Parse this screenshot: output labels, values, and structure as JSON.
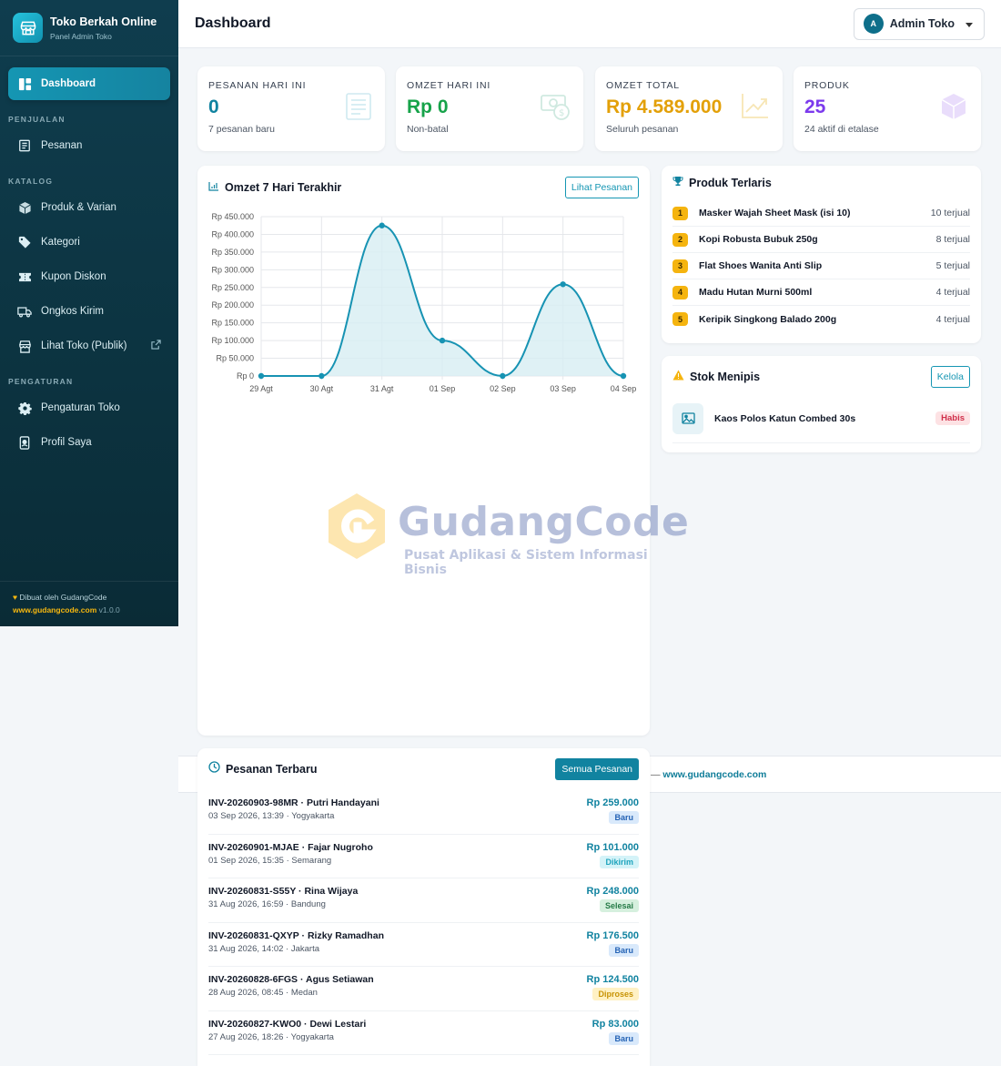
{
  "brand": {
    "title": "Toko Berkah Online",
    "subtitle": "Panel Admin Toko"
  },
  "nav": {
    "dashboard": "Dashboard",
    "section_sales": "PENJUALAN",
    "orders": "Pesanan",
    "section_catalog": "KATALOG",
    "products": "Produk & Varian",
    "categories": "Kategori",
    "coupons": "Kupon Diskon",
    "shipping": "Ongkos Kirim",
    "view_store": "Lihat Toko (Publik)",
    "section_settings": "PENGATURAN",
    "store_settings": "Pengaturan Toko",
    "profile": "Profil Saya"
  },
  "sidebar_footer": {
    "made_by": "Dibuat oleh GudangCode",
    "url": "www.gudangcode.com",
    "version": "v1.0.0"
  },
  "header": {
    "title": "Dashboard",
    "user_initial": "A",
    "user_name": "Admin Toko"
  },
  "stats": [
    {
      "label": "PESANAN HARI INI",
      "value": "0",
      "sub": "7 pesanan baru",
      "color": "#1183a0"
    },
    {
      "label": "OMZET HARI INI",
      "value": "Rp 0",
      "sub": "Non-batal",
      "color": "#17a34a"
    },
    {
      "label": "OMZET TOTAL",
      "value": "Rp 4.589.000",
      "sub": "Seluruh pesanan",
      "color": "#e3a008"
    },
    {
      "label": "PRODUK",
      "value": "25",
      "sub": "24 aktif di etalase",
      "color": "#7c3aed"
    }
  ],
  "chart_card": {
    "title": "Omzet 7 Hari Terakhir",
    "button": "Lihat Pesanan"
  },
  "chart_data": {
    "type": "area",
    "categories": [
      "29 Agt",
      "30 Agt",
      "31 Agt",
      "01 Sep",
      "02 Sep",
      "03 Sep",
      "04 Sep"
    ],
    "values": [
      0,
      0,
      425000,
      100000,
      0,
      259000,
      0
    ],
    "ylim": [
      0,
      450000
    ],
    "yticks": [
      "Rp 0",
      "Rp 50.000",
      "Rp 100.000",
      "Rp 150.000",
      "Rp 200.000",
      "Rp 250.000",
      "Rp 300.000",
      "Rp 350.000",
      "Rp 400.000",
      "Rp 450.000"
    ],
    "grid": true,
    "line_color": "#1793b3",
    "fill_color": "#d7edf3"
  },
  "best_sellers": {
    "title": "Produk Terlaris",
    "items": [
      {
        "rank": "1",
        "name": "Masker Wajah Sheet Mask (isi 10)",
        "sold": "10 terjual"
      },
      {
        "rank": "2",
        "name": "Kopi Robusta Bubuk 250g",
        "sold": "8 terjual"
      },
      {
        "rank": "3",
        "name": "Flat Shoes Wanita Anti Slip",
        "sold": "5 terjual"
      },
      {
        "rank": "4",
        "name": "Madu Hutan Murni 500ml",
        "sold": "4 terjual"
      },
      {
        "rank": "5",
        "name": "Keripik Singkong Balado 200g",
        "sold": "4 terjual"
      }
    ]
  },
  "low_stock": {
    "title": "Stok Menipis",
    "button": "Kelola",
    "items": [
      {
        "name": "Kaos Polos Katun Combed 30s",
        "status": "Habis"
      }
    ]
  },
  "footer": {
    "dash": "—",
    "url": "www.gudangcode.com"
  },
  "orders": {
    "title": "Pesanan Terbaru",
    "button": "Semua Pesanan",
    "items": [
      {
        "title": "INV-20260903-98MR · Putri Handayani",
        "meta": "03 Sep 2026, 13:39 · Yogyakarta",
        "amount": "Rp 259.000",
        "status": "Baru",
        "cls": "st-baru"
      },
      {
        "title": "INV-20260901-MJAE · Fajar Nugroho",
        "meta": "01 Sep 2026, 15:35 · Semarang",
        "amount": "Rp 101.000",
        "status": "Dikirim",
        "cls": "st-kirim"
      },
      {
        "title": "INV-20260831-S55Y · Rina Wijaya",
        "meta": "31 Aug 2026, 16:59 · Bandung",
        "amount": "Rp 248.000",
        "status": "Selesai",
        "cls": "st-selesai"
      },
      {
        "title": "INV-20260831-QXYP · Rizky Ramadhan",
        "meta": "31 Aug 2026, 14:02 · Jakarta",
        "amount": "Rp 176.500",
        "status": "Baru",
        "cls": "st-baru"
      },
      {
        "title": "INV-20260828-6FGS · Agus Setiawan",
        "meta": "28 Aug 2026, 08:45 · Medan",
        "amount": "Rp 124.500",
        "status": "Diproses",
        "cls": "st-proses"
      },
      {
        "title": "INV-20260827-KWO0 · Dewi Lestari",
        "meta": "27 Aug 2026, 18:26 · Yogyakarta",
        "amount": "Rp 83.000",
        "status": "Baru",
        "cls": "st-baru"
      }
    ]
  },
  "watermark": {
    "name": "GudangCode",
    "tagline": "Pusat Aplikasi & Sistem Informasi Bisnis"
  }
}
